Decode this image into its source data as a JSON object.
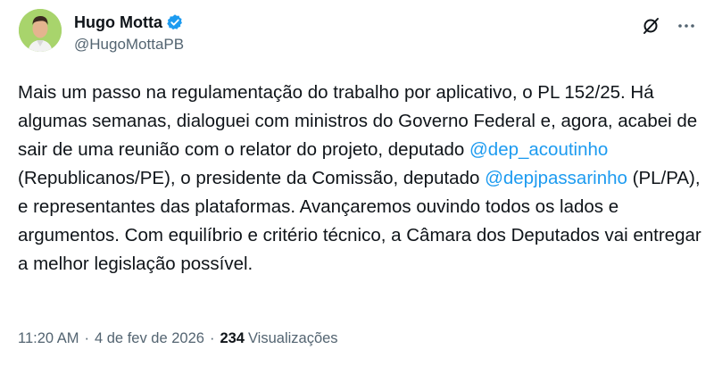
{
  "author": {
    "display_name": "Hugo Motta",
    "handle": "@HugoMottaPB",
    "verified_color": "#1d9bf0"
  },
  "icons": {
    "top_right": [
      "grok-icon",
      "more-options-icon"
    ]
  },
  "tweet": {
    "text_parts": {
      "p1": "Mais um passo na regulamentação do trabalho por aplicativo, o PL 152/25. Há algumas semanas, dialoguei com ministros do Governo Federal e, agora, acabei de sair de uma reunião com o relator do projeto, deputado ",
      "mention1": "@dep_acoutinho",
      "p2": " (Republicanos/PE), o presidente da Comissão, deputado ",
      "mention2": "@depjpassarinho",
      "p3": " (PL/PA), e representantes das plataformas. Avançaremos ouvindo todos os lados e argumentos. Com equilíbrio e critério técnico, a Câmara dos Deputados vai entregar a melhor legislação possível."
    },
    "time": "11:20 AM",
    "separator": "·",
    "date": "4 de fev de 2026",
    "views_count": "234",
    "views_label": "Visualizações"
  },
  "colors": {
    "text": "#0f1419",
    "secondary": "#536471",
    "link": "#1d9bf0"
  }
}
